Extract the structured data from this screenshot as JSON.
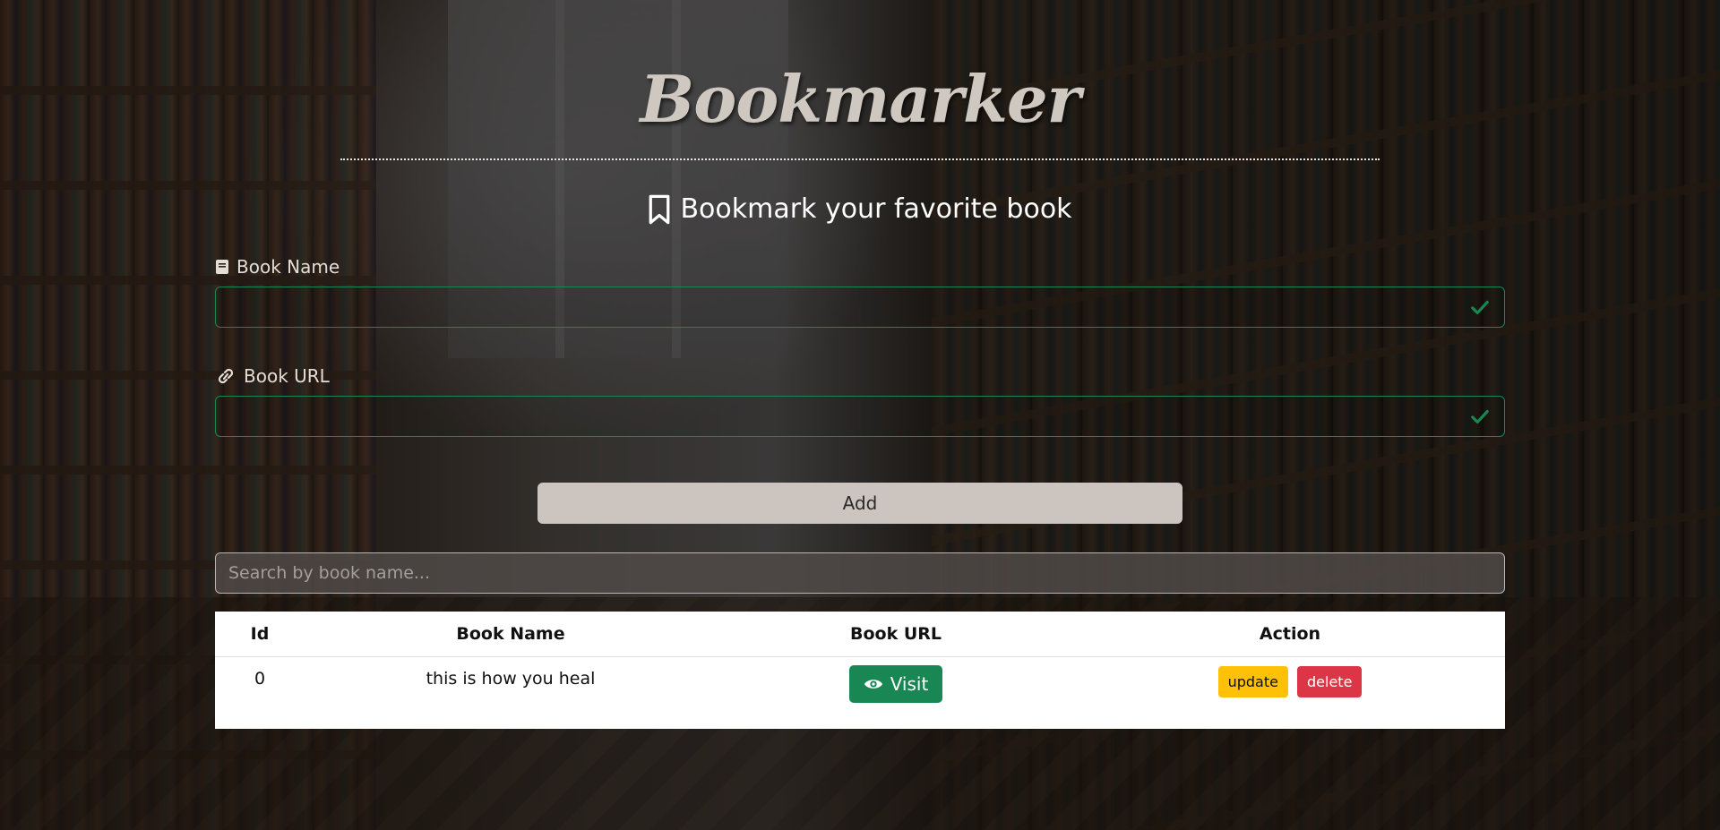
{
  "header": {
    "title": "Bookmarker",
    "subtitle": "Bookmark your favorite book"
  },
  "form": {
    "book_name_label": "Book Name",
    "book_name_value": "",
    "book_url_label": "Book URL",
    "book_url_value": "",
    "add_label": "Add"
  },
  "search": {
    "placeholder": "Search by book name..."
  },
  "table": {
    "headers": [
      "Id",
      "Book Name",
      "Book URL",
      "Action"
    ],
    "rows": [
      {
        "id": "0",
        "name": "this is how you heal",
        "visit_label": "Visit",
        "update_label": "update",
        "delete_label": "delete"
      }
    ]
  },
  "colors": {
    "valid_green": "#198754",
    "update_yellow": "#ffc107",
    "delete_red": "#dc3545",
    "add_button_bg": "#ccc5bf"
  },
  "icons": {
    "subtitle": "bookmark-icon",
    "book_name": "book-icon",
    "book_url": "link-icon",
    "field_valid": "check-icon",
    "visit": "eye-icon"
  }
}
